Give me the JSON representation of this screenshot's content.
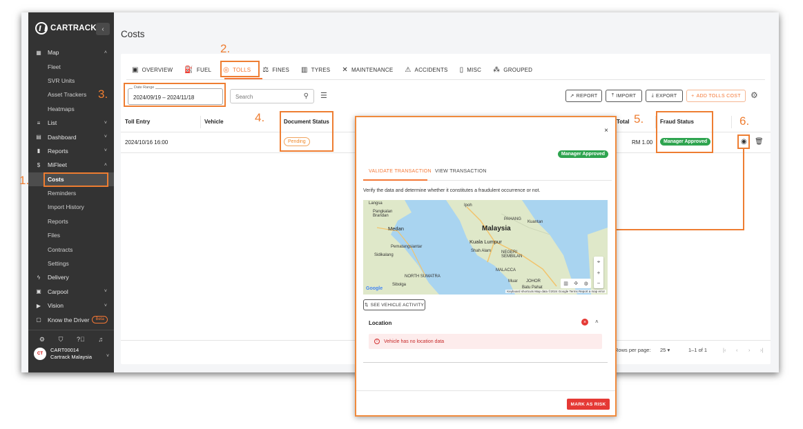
{
  "brand": {
    "name": "CARTRACK",
    "collapse_icon": "chevron-left-icon"
  },
  "sidebar": {
    "items": [
      {
        "label": "Map",
        "icon": "map-icon",
        "chevron": "˄",
        "sub": false,
        "active": false
      },
      {
        "label": "Fleet",
        "sub": true,
        "active": false
      },
      {
        "label": "SVR Units",
        "sub": true,
        "active": false
      },
      {
        "label": "Asset Trackers",
        "sub": true,
        "active": false
      },
      {
        "label": "Heatmaps",
        "sub": true,
        "active": false
      },
      {
        "label": "List",
        "icon": "list-icon",
        "chevron": "˅",
        "sub": false,
        "active": false
      },
      {
        "label": "Dashboard",
        "icon": "dashboard-icon",
        "chevron": "˅",
        "sub": false,
        "active": false
      },
      {
        "label": "Reports",
        "icon": "reports-icon",
        "chevron": "˅",
        "sub": false,
        "active": false
      },
      {
        "label": "MiFleet",
        "icon": "dollar-icon",
        "chevron": "˄",
        "sub": false,
        "active": false
      },
      {
        "label": "Costs",
        "sub": true,
        "active": true
      },
      {
        "label": "Reminders",
        "sub": true,
        "active": false
      },
      {
        "label": "Import History",
        "sub": true,
        "active": false
      },
      {
        "label": "Reports",
        "sub": true,
        "active": false
      },
      {
        "label": "Files",
        "sub": true,
        "active": false
      },
      {
        "label": "Contracts",
        "sub": true,
        "active": false
      },
      {
        "label": "Settings",
        "sub": true,
        "active": false
      },
      {
        "label": "Delivery",
        "icon": "delivery-icon",
        "chevron": "",
        "sub": false,
        "active": false
      },
      {
        "label": "Carpool",
        "icon": "carpool-icon",
        "chevron": "˅",
        "sub": false,
        "active": false
      },
      {
        "label": "Vision",
        "icon": "vision-icon",
        "chevron": "˅",
        "sub": false,
        "active": false
      },
      {
        "label": "Know the Driver",
        "icon": "driver-icon",
        "chevron": "",
        "sub": false,
        "active": false,
        "badge": "Beta"
      }
    ],
    "footer_icons": [
      "settings-icon",
      "shield-icon",
      "help-icon",
      "bell-icon"
    ],
    "account": {
      "code": "CART00014",
      "company": "Cartrack Malaysia"
    }
  },
  "page": {
    "title": "Costs"
  },
  "tabs": [
    {
      "label": "OVERVIEW",
      "icon": "overview-icon",
      "active": false
    },
    {
      "label": "FUEL",
      "icon": "fuel-icon",
      "active": false
    },
    {
      "label": "TOLLS",
      "icon": "tolls-icon",
      "active": true
    },
    {
      "label": "FINES",
      "icon": "fines-icon",
      "active": false
    },
    {
      "label": "TYRES",
      "icon": "tyres-icon",
      "active": false
    },
    {
      "label": "MAINTENANCE",
      "icon": "maintenance-icon",
      "active": false
    },
    {
      "label": "ACCIDENTS",
      "icon": "accidents-icon",
      "active": false
    },
    {
      "label": "MISC",
      "icon": "misc-icon",
      "active": false
    },
    {
      "label": "GROUPED",
      "icon": "grouped-icon",
      "active": false
    }
  ],
  "toolbar": {
    "date_range_label": "Date Range",
    "date_range_value": "2024/09/19 – 2024/11/18",
    "search_placeholder": "Search",
    "report_label": "REPORT",
    "import_label": "IMPORT",
    "export_label": "EXPORT",
    "add_label": "ADD TOLLS COST"
  },
  "table": {
    "headers": [
      "Toll Entry",
      "Vehicle",
      "Document Status",
      "Total",
      "Fraud Status"
    ],
    "rows": [
      {
        "toll_entry": "2024/10/16 16:00",
        "vehicle": "",
        "document_status": "Pending",
        "total": "RM 1.00",
        "fraud_status": "Manager Approved"
      }
    ],
    "pagination": {
      "rows_per_page_label": "Rows per page:",
      "rows_per_page": "25",
      "range": "1–1 of 1"
    }
  },
  "modal": {
    "status_badge": "Manager Approved",
    "tabs": [
      "VALIDATE TRANSACTION",
      "VIEW TRANSACTION"
    ],
    "instruction": "Verify the data and determine whether it constitutes a fraudulent occurrence or not.",
    "map": {
      "labels": [
        "Langsa",
        "Ipoh",
        "Pangkalan Brandan",
        "Medan",
        "Malaysia",
        "PAHANG",
        "Kuantan",
        "Pematangsiantar",
        "Kuala Lumpur",
        "Shah Alam",
        "NEGERI SEMBILAN",
        "Sidikalang",
        "NORTH SUMATRA",
        "MALACCA",
        "Muar",
        "JOHOR",
        "Sibolga",
        "Batu Pahat"
      ],
      "attribution": "Keyboard shortcuts  Map data ©2024 Google  Terms  Report a map error",
      "google": "Google"
    },
    "see_activity_label": "SEE VEHICLE ACTIVITY",
    "location_title": "Location",
    "location_error": "Vehicle has no location data",
    "mark_risk_label": "MARK AS RISK"
  },
  "callouts": [
    "1.",
    "2.",
    "3.",
    "4.",
    "5.",
    "6."
  ],
  "colors": {
    "accent": "#f47735",
    "sidebar": "#333333",
    "approved": "#2ea44f",
    "danger": "#e53935"
  }
}
